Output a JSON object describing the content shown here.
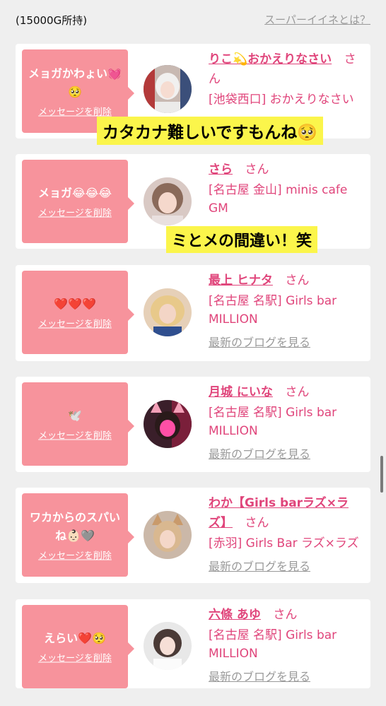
{
  "header": {
    "balance": "(15000G所持)",
    "super_link": "スーパーイイネとは？"
  },
  "cards": [
    {
      "message": "メョガかわょい💓🥺",
      "delete_label": "メッセージを削除",
      "name": "りこ💫おかえりなさい",
      "san": "さん",
      "shop": "[池袋西口] おかえりなさい",
      "blog": "",
      "avatar": "avatar-1"
    },
    {
      "message": "メョガ😂😂😂",
      "delete_label": "メッセージを削除",
      "name": "さら",
      "san": "さん",
      "shop": "[名古屋 金山] minis cafe GM",
      "blog": "",
      "avatar": "avatar-2"
    },
    {
      "message": "❤️❤️❤️",
      "delete_label": "メッセージを削除",
      "name": "最上 ヒナタ",
      "san": "さん",
      "shop": "[名古屋 名駅] Girls bar MILLION",
      "blog": "最新のブログを見る",
      "avatar": "avatar-3"
    },
    {
      "message": "🕊️",
      "delete_label": "メッセージを削除",
      "name": "月城 にいな",
      "san": "さん",
      "shop": "[名古屋 名駅] Girls bar MILLION",
      "blog": "最新のブログを見る",
      "avatar": "avatar-4"
    },
    {
      "message": "ワカからのスパいね👶🏻🩶",
      "delete_label": "メッセージを削除",
      "name": "わか【Girls barラズ×ラズ】",
      "san": "さん",
      "shop": "[赤羽] Girls Bar ラズ×ラズ",
      "blog": "最新のブログを見る",
      "avatar": "avatar-5"
    },
    {
      "message": "えらい❤️🥺",
      "delete_label": "メッセージを削除",
      "name": "六條 あゆ",
      "san": "さん",
      "shop": "[名古屋 名駅] Girls bar MILLION",
      "blog": "最新のブログを見る",
      "avatar": "avatar-6"
    }
  ],
  "captions": [
    "カタカナ難しいですもんね🥺",
    "ミとメの間違い！笑"
  ],
  "colors": {
    "bubble": "#f7939c",
    "accent": "#e0457b",
    "caption_bg": "#fbf54b",
    "page_bg": "#efefef"
  }
}
